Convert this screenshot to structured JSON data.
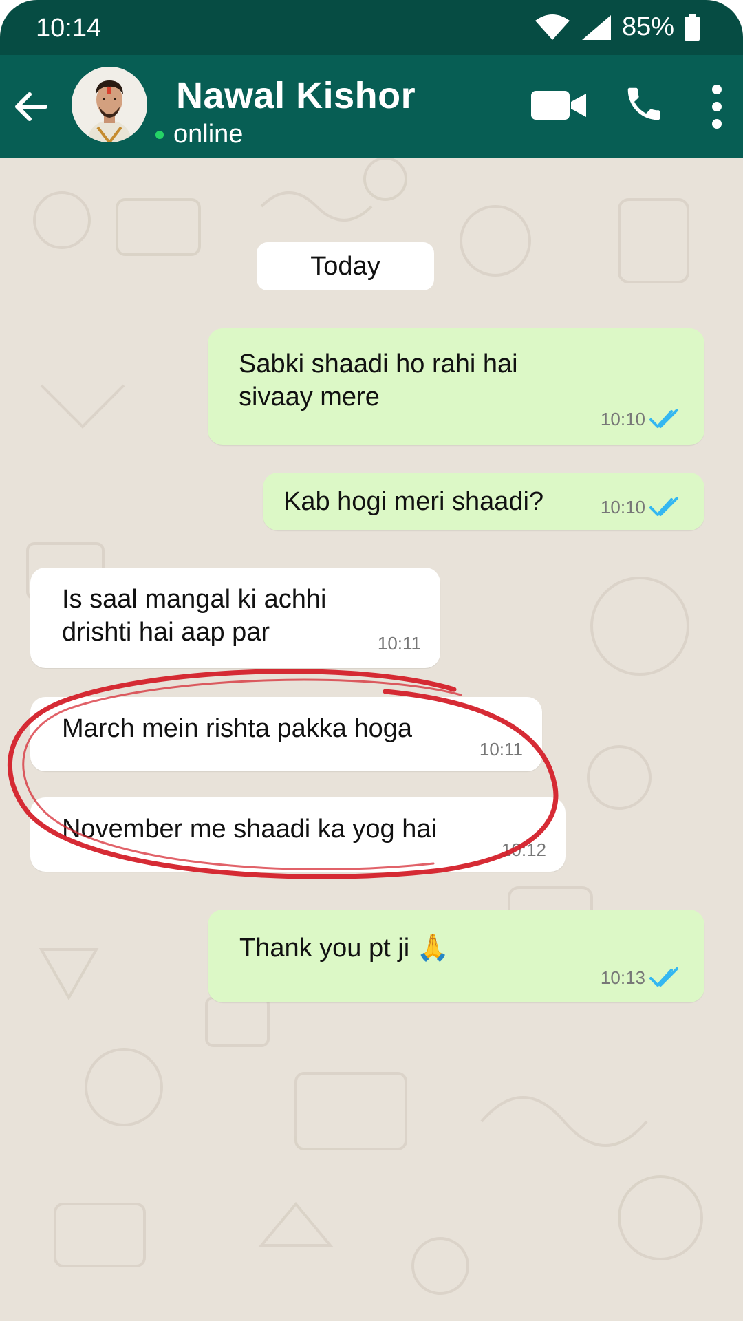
{
  "status_bar": {
    "time": "10:14",
    "battery": "85%"
  },
  "header": {
    "contact_name": "Nawal Kishor",
    "presence": "online",
    "icons": [
      "back-arrow-icon",
      "avatar",
      "video-call-icon",
      "phone-icon",
      "more-vert-icon"
    ]
  },
  "chat": {
    "date_chip": "Today",
    "messages": [
      {
        "direction": "out",
        "lines": [
          "Sabki shaadi ho rahi hai",
          "sivaay mere"
        ],
        "time": "10:10",
        "status": "read"
      },
      {
        "direction": "out",
        "lines": [
          "Kab hogi meri shaadi?"
        ],
        "time": "10:10",
        "status": "read"
      },
      {
        "direction": "in",
        "lines": [
          "Is saal mangal ki achhi",
          "drishti hai aap par"
        ],
        "time": "10:11"
      },
      {
        "direction": "in",
        "lines": [
          "March mein rishta pakka hoga"
        ],
        "time": "10:11"
      },
      {
        "direction": "in",
        "lines": [
          "November me shaadi ka yog hai"
        ],
        "time": "10:12"
      },
      {
        "direction": "out",
        "lines": [
          "Thank you pt ji 🙏"
        ],
        "time": "10:13",
        "status": "read"
      }
    ]
  },
  "colors": {
    "header": "#075e54",
    "status_bar": "#064c43",
    "outgoing_bubble": "#dcf8c6",
    "incoming_bubble": "#ffffff",
    "read_ticks": "#34b7f1",
    "highlight_circle": "#d4202a",
    "chat_background": "#e8e2d9"
  }
}
